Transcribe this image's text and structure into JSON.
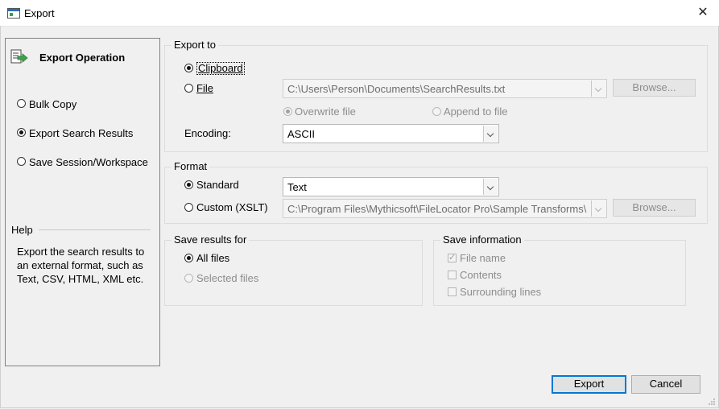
{
  "window": {
    "title": "Export"
  },
  "left": {
    "operation_title": "Export Operation",
    "options": [
      {
        "label": "Bulk Copy",
        "checked": false
      },
      {
        "label": "Export Search Results",
        "checked": true
      },
      {
        "label": "Save Session/Workspace",
        "checked": false
      }
    ],
    "help_label": "Help",
    "help_lines": [
      "Export the search results to",
      "an external format, such as",
      "Text, CSV, HTML, XML etc."
    ]
  },
  "export_to": {
    "label": "Export to",
    "clipboard": "Clipboard",
    "file": "File",
    "file_path": "C:\\Users\\Person\\Documents\\SearchResults.txt",
    "browse": "Browse...",
    "overwrite": "Overwrite file",
    "append": "Append to file",
    "encoding_label": "Encoding:",
    "encoding_value": "ASCII"
  },
  "format": {
    "label": "Format",
    "standard": "Standard",
    "standard_value": "Text",
    "custom": "Custom (XSLT)",
    "custom_path": "C:\\Program Files\\Mythicsoft\\FileLocator Pro\\Sample Transforms\\",
    "browse": "Browse..."
  },
  "save_results": {
    "label": "Save results for",
    "all_files": "All files",
    "selected_files": "Selected files"
  },
  "save_info": {
    "label": "Save information",
    "file_name": "File name",
    "contents": "Contents",
    "surrounding_lines": "Surrounding lines"
  },
  "buttons": {
    "export": "Export",
    "cancel": "Cancel"
  }
}
